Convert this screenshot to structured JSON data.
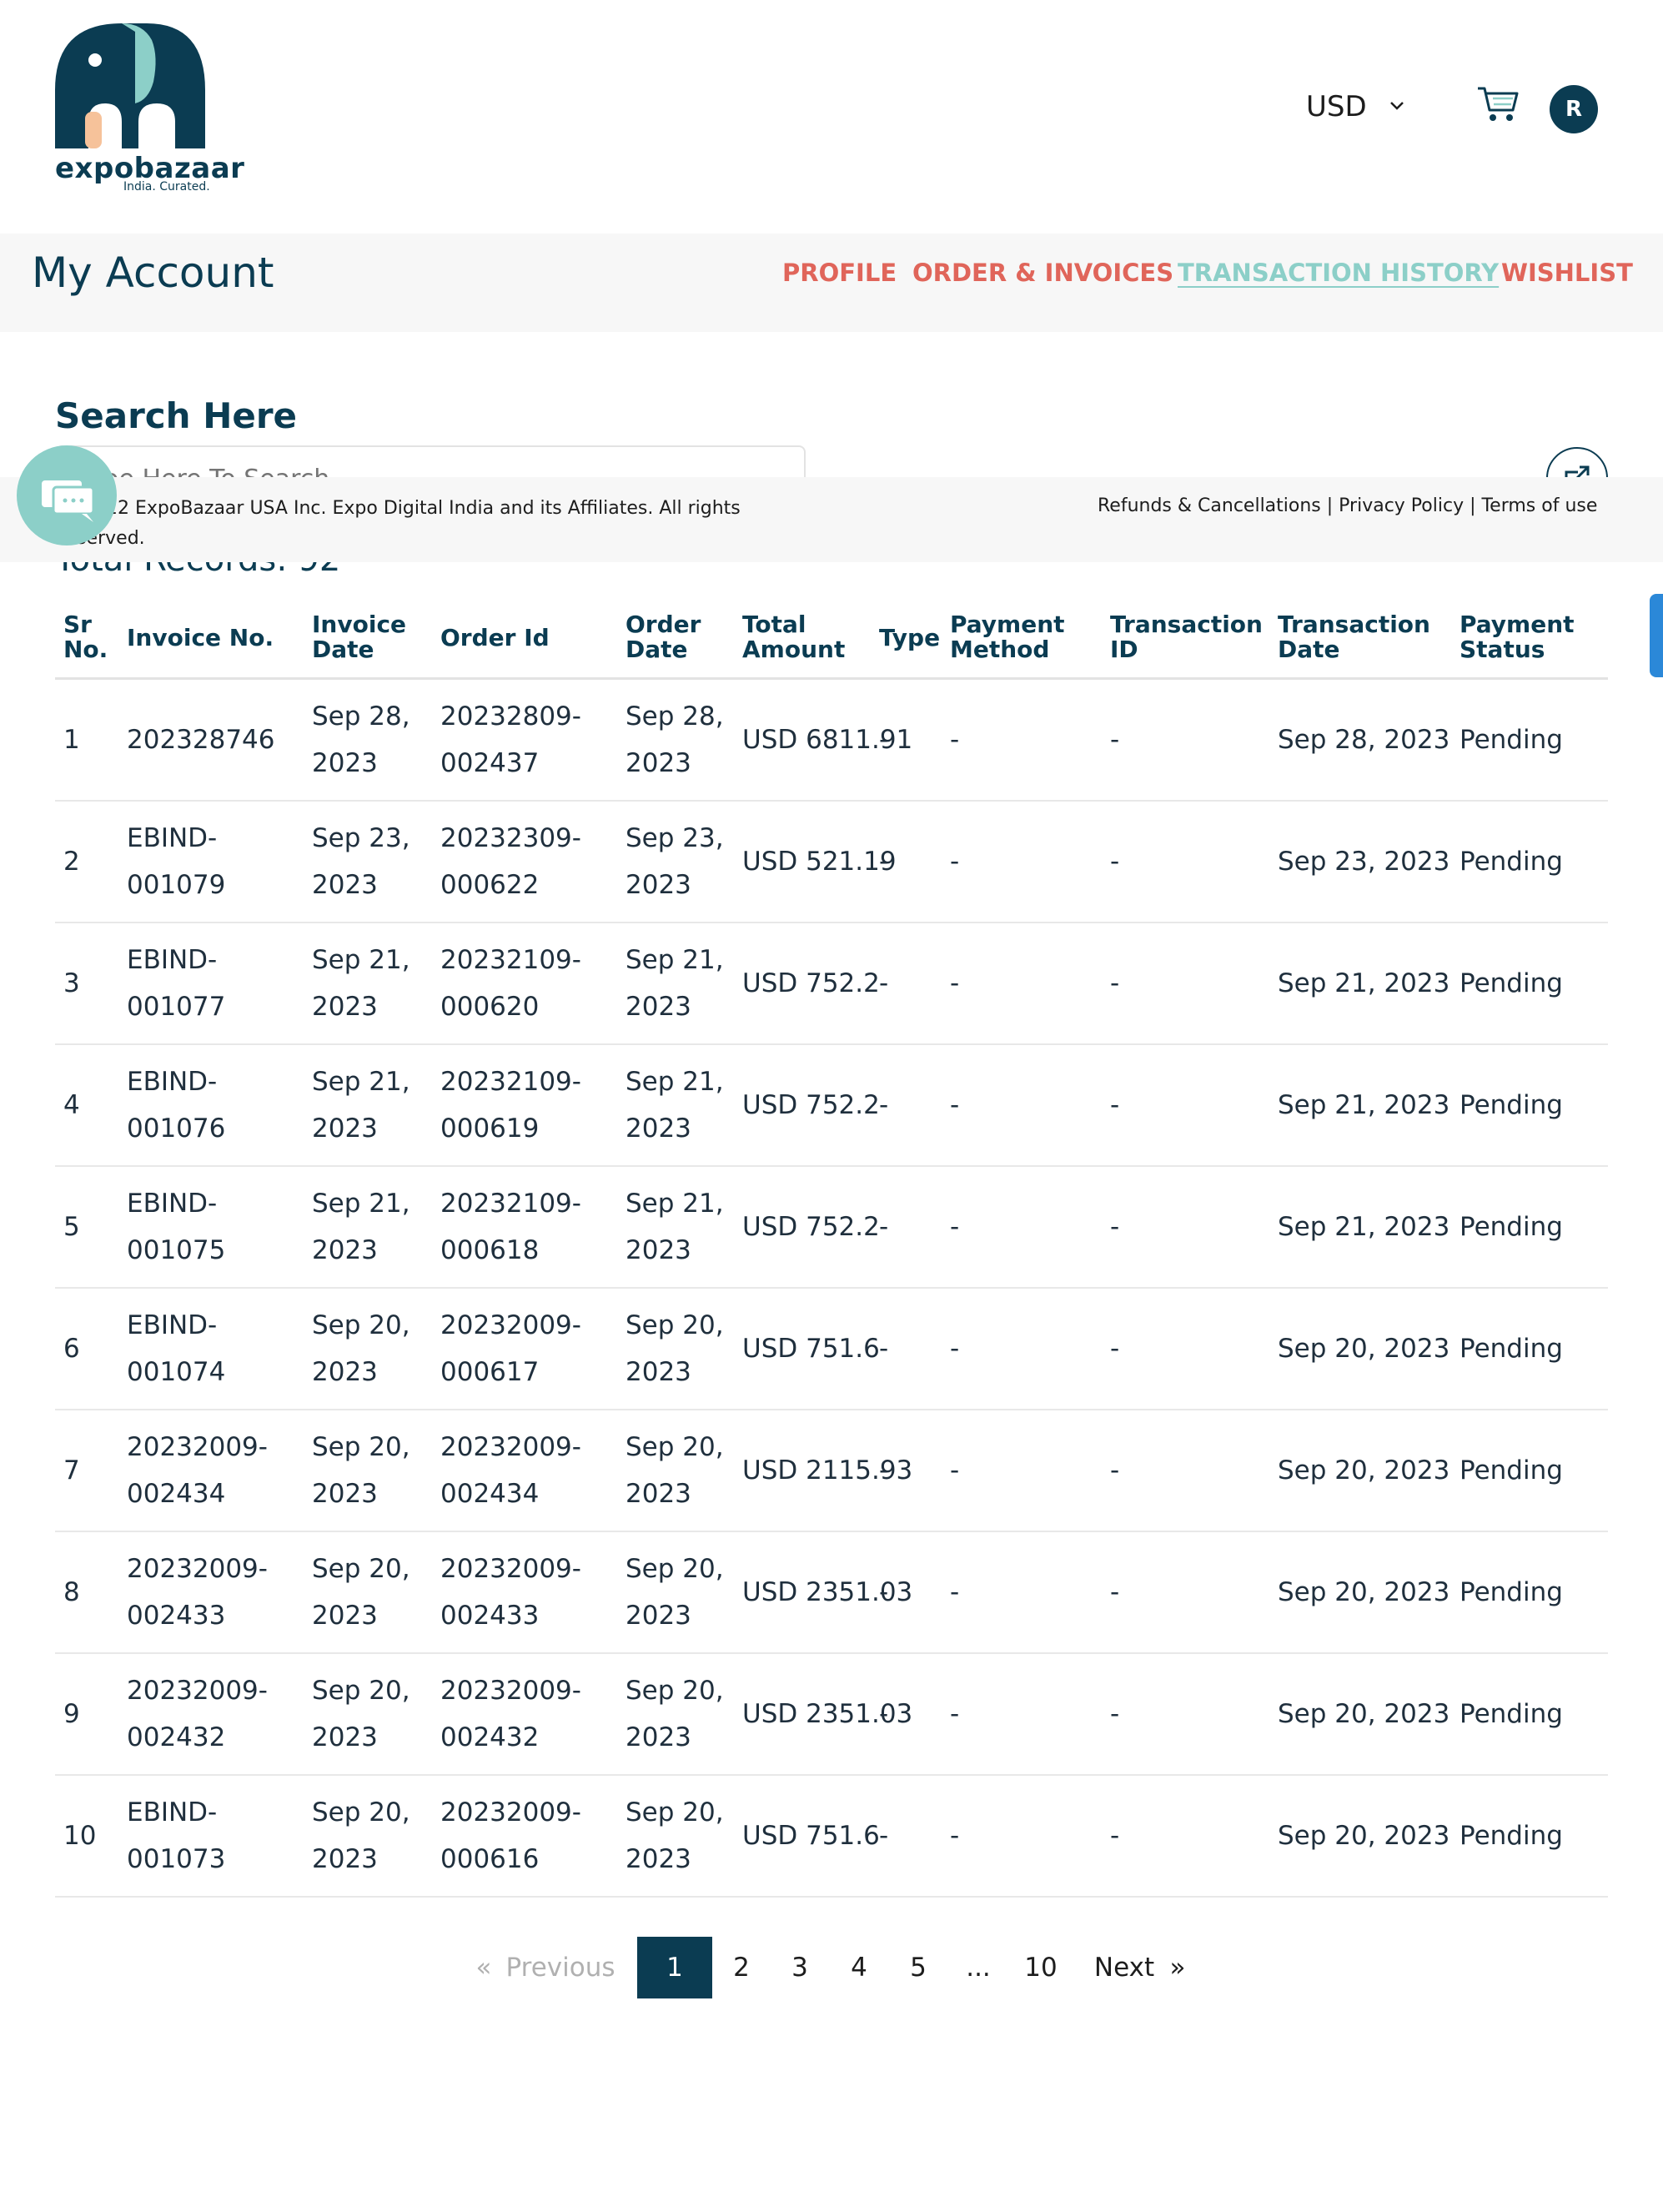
{
  "header": {
    "logo_word": "expobazaar",
    "logo_tagline": "India. Curated.",
    "currency": "USD",
    "avatar_initial": "R"
  },
  "account": {
    "title": "My Account",
    "nav": [
      "PROFILE",
      "ORDER & INVOICES",
      "TRANSACTION HISTORY",
      "WISHLIST"
    ],
    "active_nav": "TRANSACTION HISTORY"
  },
  "search": {
    "title": "Search Here",
    "placeholder": "Type Here To Search"
  },
  "total_records_label": "Total Records: 92",
  "footer": {
    "copyright": "© 2022 ExpoBazaar USA Inc. Expo Digital India and its Affiliates. All rights reserved.",
    "links": "Refunds & Cancellations | Privacy Policy | Terms of use"
  },
  "table": {
    "headers": [
      "Sr No.",
      "Invoice No.",
      "Invoice Date",
      "Order Id",
      "Order Date",
      "Total Amount",
      "Type",
      "Payment Method",
      "Transaction ID",
      "Transaction Date",
      "Payment Status"
    ],
    "rows": [
      [
        "1",
        "202328746",
        "Sep 28, 2023",
        "20232809-002437",
        "Sep 28, 2023",
        "USD 6811.91",
        "-",
        "-",
        "-",
        "Sep 28, 2023",
        "Pending"
      ],
      [
        "2",
        "EBIND-001079",
        "Sep 23, 2023",
        "20232309-000622",
        "Sep 23, 2023",
        "USD 521.19",
        "-",
        "-",
        "-",
        "Sep 23, 2023",
        "Pending"
      ],
      [
        "3",
        "EBIND-001077",
        "Sep 21, 2023",
        "20232109-000620",
        "Sep 21, 2023",
        "USD 752.2",
        "-",
        "-",
        "-",
        "Sep 21, 2023",
        "Pending"
      ],
      [
        "4",
        "EBIND-001076",
        "Sep 21, 2023",
        "20232109-000619",
        "Sep 21, 2023",
        "USD 752.2",
        "-",
        "-",
        "-",
        "Sep 21, 2023",
        "Pending"
      ],
      [
        "5",
        "EBIND-001075",
        "Sep 21, 2023",
        "20232109-000618",
        "Sep 21, 2023",
        "USD 752.2",
        "-",
        "-",
        "-",
        "Sep 21, 2023",
        "Pending"
      ],
      [
        "6",
        "EBIND-001074",
        "Sep 20, 2023",
        "20232009-000617",
        "Sep 20, 2023",
        "USD 751.6",
        "-",
        "-",
        "-",
        "Sep 20, 2023",
        "Pending"
      ],
      [
        "7",
        "20232009-002434",
        "Sep 20, 2023",
        "20232009-002434",
        "Sep 20, 2023",
        "USD 2115.93",
        "-",
        "-",
        "-",
        "Sep 20, 2023",
        "Pending"
      ],
      [
        "8",
        "20232009-002433",
        "Sep 20, 2023",
        "20232009-002433",
        "Sep 20, 2023",
        "USD 2351.03",
        "-",
        "-",
        "-",
        "Sep 20, 2023",
        "Pending"
      ],
      [
        "9",
        "20232009-002432",
        "Sep 20, 2023",
        "20232009-002432",
        "Sep 20, 2023",
        "USD 2351.03",
        "-",
        "-",
        "-",
        "Sep 20, 2023",
        "Pending"
      ],
      [
        "10",
        "EBIND-001073",
        "Sep 20, 2023",
        "20232009-000616",
        "Sep 20, 2023",
        "USD 751.6",
        "-",
        "-",
        "-",
        "Sep 20, 2023",
        "Pending"
      ]
    ]
  },
  "pagination": {
    "prev_arrow": "«",
    "previous": "Previous",
    "pages": [
      "1",
      "2",
      "3",
      "4",
      "5",
      "...",
      "10"
    ],
    "current": "1",
    "next": "Next",
    "next_arrow": "»"
  },
  "colors": {
    "navy": "#0b3c52",
    "teal": "#8ccfc8",
    "coral": "#e0655a",
    "peach": "#f6c29a"
  }
}
